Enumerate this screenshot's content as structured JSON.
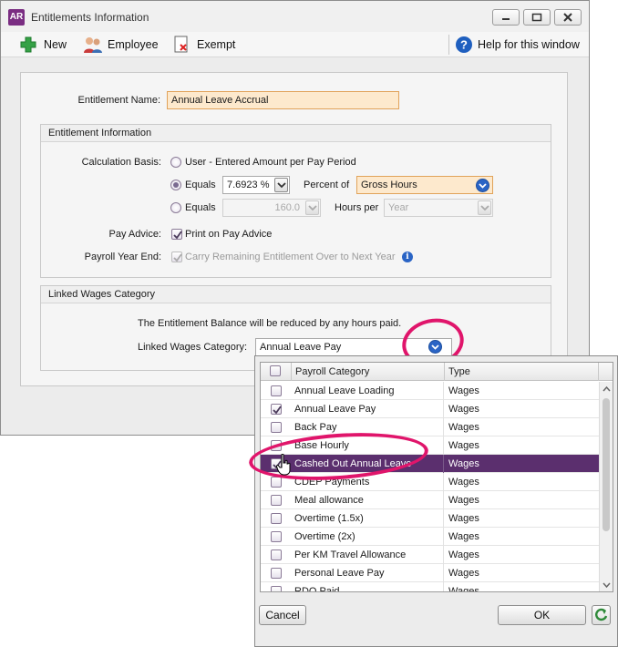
{
  "window": {
    "app_badge": "AR",
    "title": "Entitlements Information"
  },
  "toolbar": {
    "new_label": "New",
    "employee_label": "Employee",
    "exempt_label": "Exempt",
    "help_label": "Help for this window"
  },
  "form": {
    "entitlement_name_label": "Entitlement Name:",
    "entitlement_name_value": "Annual Leave Accrual",
    "entitlement_info_header": "Entitlement Information",
    "calculation_basis_label": "Calculation Basis:",
    "option_user_label": "User - Entered Amount per Pay Period",
    "option_equals_label": "Equals",
    "equals_percent_value": "7.6923 %",
    "percent_of_label": "Percent of",
    "percent_of_value": "Gross Hours",
    "option_equals2_label": "Equals",
    "equals_hours_value": "160.0",
    "hours_per_label": "Hours per",
    "hours_per_value": "Year",
    "pay_advice_label": "Pay Advice:",
    "print_on_pay_advice_label": "Print on Pay Advice",
    "payroll_year_end_label": "Payroll Year End:",
    "carry_remaining_label": "Carry Remaining Entitlement Over to Next Year",
    "linked_wages_header": "Linked Wages Category",
    "balance_note": "The Entitlement Balance will be reduced by any hours paid.",
    "linked_wages_label": "Linked Wages Category:",
    "linked_wages_value": "Annual Leave Pay"
  },
  "popup": {
    "col_category": "Payroll Category",
    "col_type": "Type",
    "rows": [
      {
        "name": "Annual Leave Loading",
        "type": "Wages",
        "checked": false,
        "selected": false
      },
      {
        "name": "Annual Leave Pay",
        "type": "Wages",
        "checked": true,
        "selected": false
      },
      {
        "name": "Back Pay",
        "type": "Wages",
        "checked": false,
        "selected": false
      },
      {
        "name": "Base Hourly",
        "type": "Wages",
        "checked": false,
        "selected": false
      },
      {
        "name": "Cashed Out Annual Leave",
        "type": "Wages",
        "checked": true,
        "selected": true
      },
      {
        "name": "CDEP Payments",
        "type": "Wages",
        "checked": false,
        "selected": false
      },
      {
        "name": "Meal allowance",
        "type": "Wages",
        "checked": false,
        "selected": false
      },
      {
        "name": "Overtime (1.5x)",
        "type": "Wages",
        "checked": false,
        "selected": false
      },
      {
        "name": "Overtime (2x)",
        "type": "Wages",
        "checked": false,
        "selected": false
      },
      {
        "name": "Per KM Travel Allowance",
        "type": "Wages",
        "checked": false,
        "selected": false
      },
      {
        "name": "Personal Leave Pay",
        "type": "Wages",
        "checked": false,
        "selected": false
      },
      {
        "name": "RDO Paid",
        "type": "Wages",
        "checked": false,
        "selected": false
      }
    ],
    "cancel_label": "Cancel",
    "ok_label": "OK"
  },
  "colors": {
    "accent_purple": "#5b2f6e",
    "highlight_pink": "#e0156b",
    "field_orange": "#fde9cd",
    "help_blue": "#2a64c5"
  }
}
